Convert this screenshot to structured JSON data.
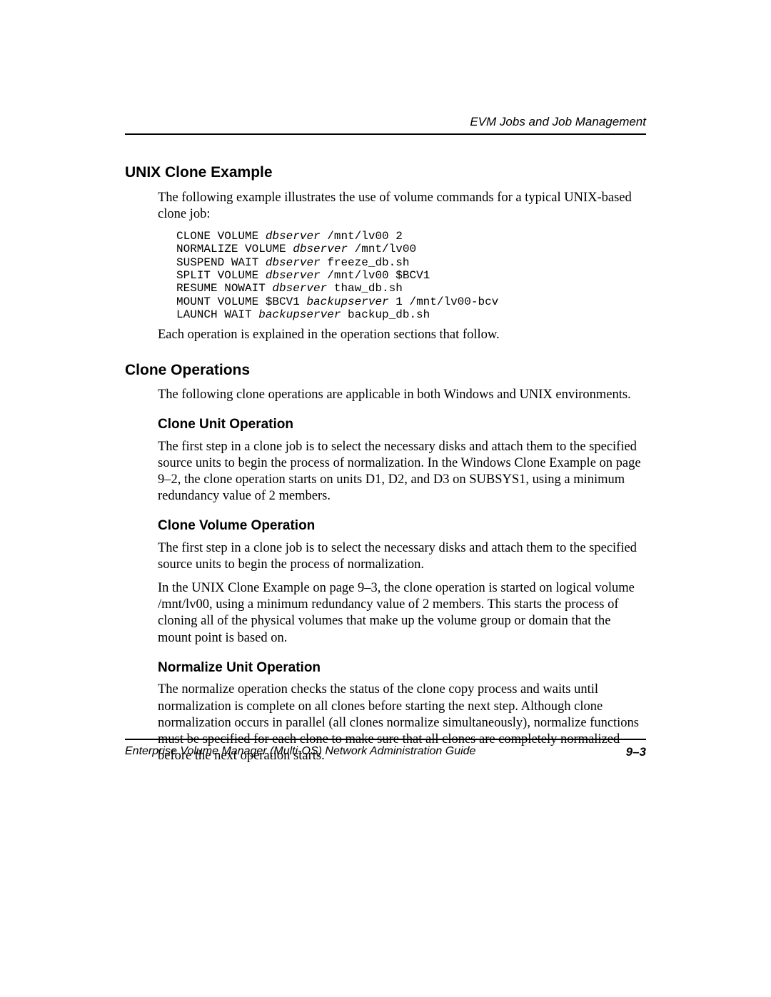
{
  "header": {
    "running_title": "EVM Jobs and Job Management"
  },
  "sections": {
    "unix_clone": {
      "heading": "UNIX Clone Example",
      "intro": "The following example illustrates the use of volume commands for a typical UNIX-based clone job:",
      "code": {
        "l1a": "CLONE VOLUME ",
        "l1b": "dbserver",
        "l1c": " /mnt/lv00 2",
        "l2a": "NORMALIZE VOLUME ",
        "l2b": "dbserver",
        "l2c": " /mnt/lv00",
        "l3a": "SUSPEND WAIT ",
        "l3b": "dbserver",
        "l3c": " freeze_db.sh",
        "l4a": "SPLIT VOLUME ",
        "l4b": "dbserver",
        "l4c": " /mnt/lv00 $BCV1",
        "l5a": "RESUME NOWAIT ",
        "l5b": "dbserver",
        "l5c": " thaw_db.sh",
        "l6a": "MOUNT VOLUME $BCV1 ",
        "l6b": "backupserver",
        "l6c": " 1 /mnt/lv00-bcv",
        "l7a": "LAUNCH WAIT ",
        "l7b": "backupserver",
        "l7c": " backup_db.sh"
      },
      "outro": "Each operation is explained in the operation sections that follow."
    },
    "clone_ops": {
      "heading": "Clone Operations",
      "intro": "The following clone operations are applicable in both Windows and UNIX environments.",
      "unit": {
        "heading": "Clone Unit Operation",
        "body": "The first step in a clone job is to select the necessary disks and attach them to the specified source units to begin the process of normalization. In the Windows Clone Example on page 9–2, the clone operation starts on units D1, D2, and D3 on SUBSYS1, using a minimum redundancy value of 2 members."
      },
      "volume": {
        "heading": "Clone Volume Operation",
        "body1": "The first step in a clone job is to select the necessary disks and attach them to the specified source units to begin the process of normalization.",
        "body2": "In the UNIX Clone Example on page 9–3, the clone operation is started on logical volume /mnt/lv00, using a minimum redundancy value of 2 members. This starts the process of cloning all of the physical volumes that make up the volume group or domain that the mount point is based on."
      },
      "normalize": {
        "heading": "Normalize Unit Operation",
        "body": "The normalize operation checks the status of the clone copy process and waits until normalization is complete on all clones before starting the next step. Although clone normalization occurs in parallel (all clones normalize simultaneously), normalize functions must be specified for each clone to make sure that all clones are completely normalized before the next operation starts."
      }
    }
  },
  "footer": {
    "book_title": "Enterprise Volume Manager (Multi-OS) Network Administration Guide",
    "page_number": "9–3"
  }
}
